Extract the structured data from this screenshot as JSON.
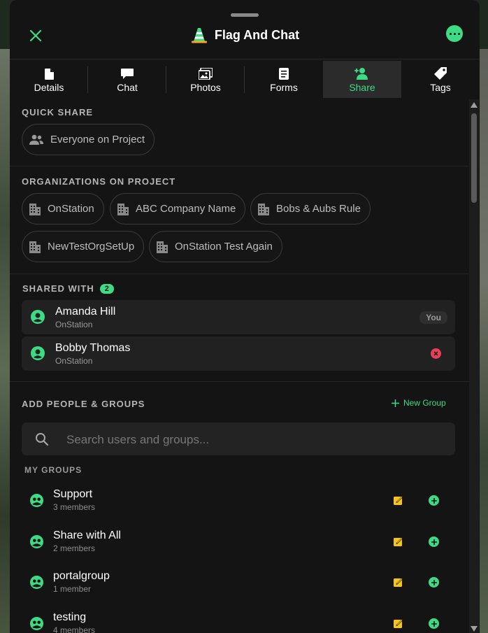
{
  "header": {
    "title": "Flag And Chat",
    "close_icon": "close-icon",
    "more_icon": "more-options-icon"
  },
  "tabs": [
    {
      "label": "Details",
      "icon": "document-icon"
    },
    {
      "label": "Chat",
      "icon": "chat-icon"
    },
    {
      "label": "Photos",
      "icon": "photos-icon"
    },
    {
      "label": "Forms",
      "icon": "forms-icon"
    },
    {
      "label": "Share",
      "icon": "add-user-icon",
      "active": true
    },
    {
      "label": "Tags",
      "icon": "tag-icon"
    }
  ],
  "quick_share": {
    "title": "QUICK SHARE",
    "chip": "Everyone on Project"
  },
  "organizations": {
    "title": "ORGANIZATIONS ON PROJECT",
    "items": [
      "OnStation",
      "ABC Company Name",
      "Bobs & Aubs Rule",
      "NewTestOrgSetUp",
      "OnStation Test Again"
    ]
  },
  "shared_with": {
    "title": "SHARED WITH",
    "count": "2",
    "people": [
      {
        "name": "Amanda Hill",
        "org": "OnStation",
        "tag": "You"
      },
      {
        "name": "Bobby Thomas",
        "org": "OnStation"
      }
    ]
  },
  "add_people": {
    "title": "ADD PEOPLE & GROUPS",
    "new_group": "New Group",
    "search_placeholder": "Search users and groups..."
  },
  "my_groups": {
    "title": "MY GROUPS",
    "groups": [
      {
        "name": "Support",
        "count": "3 members"
      },
      {
        "name": "Share with All",
        "count": "2 members"
      },
      {
        "name": "portalgroup",
        "count": "1 member"
      },
      {
        "name": "testing",
        "count": "4 members"
      }
    ]
  },
  "colors": {
    "accent": "#3ddc84",
    "edit": "#f5c518",
    "remove": "#e8405a",
    "panel_bg": "#141414"
  }
}
